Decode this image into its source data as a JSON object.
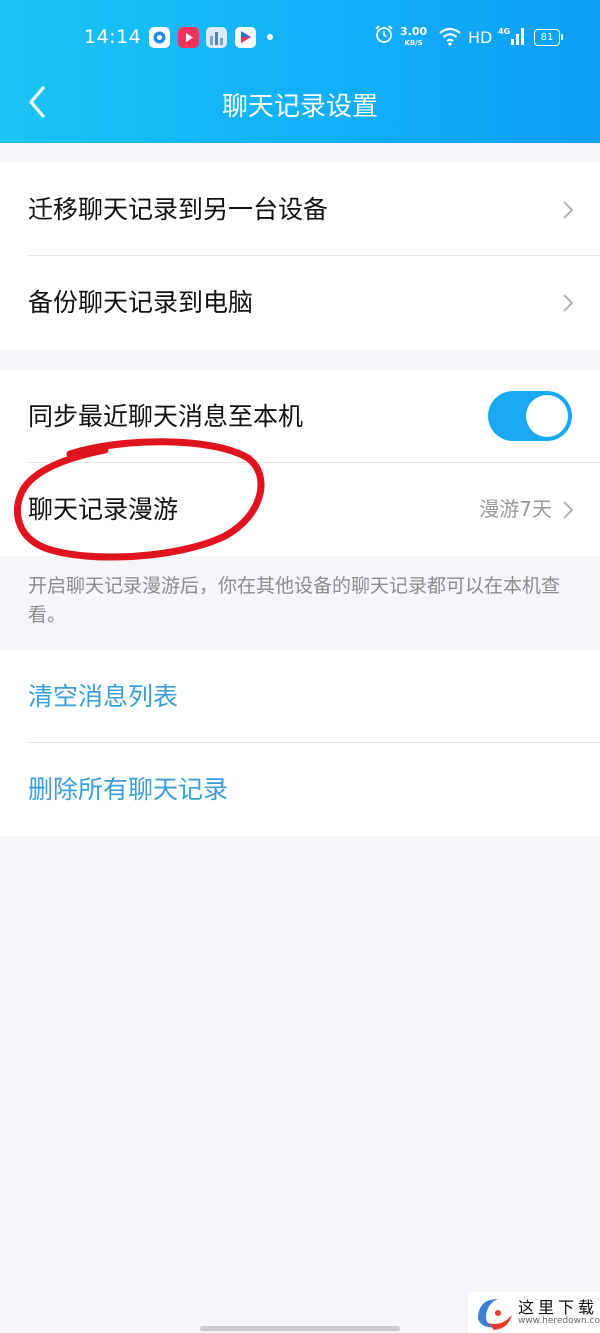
{
  "status_bar": {
    "time": "14:14",
    "net_speed": "3.00",
    "net_speed_unit": "KB/S",
    "network": "HD",
    "signal": "4G",
    "battery": "81"
  },
  "header": {
    "title": "聊天记录设置"
  },
  "group1": {
    "items": [
      {
        "label": "迁移聊天记录到另一台设备",
        "icon": "chevron-right-icon"
      },
      {
        "label": "备份聊天记录到电脑",
        "icon": "chevron-right-icon"
      }
    ]
  },
  "group2": {
    "sync_label": "同步最近聊天消息至本机",
    "sync_enabled": true,
    "roaming_label": "聊天记录漫游",
    "roaming_value": "漫游7天"
  },
  "note": "开启聊天记录漫游后，你在其他设备的聊天记录都可以在本机查看。",
  "group3": {
    "clear_label": "清空消息列表",
    "delete_label": "删除所有聊天记录"
  },
  "watermark": {
    "text": "这里下载",
    "url": "www.heredown.com"
  },
  "colors": {
    "header": "#11b0f8",
    "accent_text": "#3a9fd8",
    "toggle_on": "#19a9f2",
    "annotation": "#e0141e"
  }
}
